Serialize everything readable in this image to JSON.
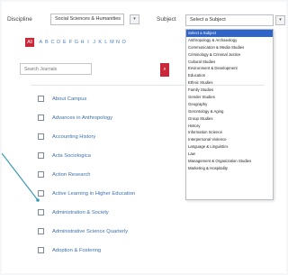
{
  "filters": {
    "discipline_label": "Discipline",
    "discipline_value": "Social Sciences & Humanities",
    "subject_label": "Subject",
    "subject_value": "Select a Subject"
  },
  "subject_options": [
    "Select a Subject",
    "Anthropology & Archaeology",
    "Communication & Media Studies",
    "Criminology & Criminal Justice",
    "Cultural Studies",
    "Environment & Development",
    "Education",
    "Ethnic Studies",
    "Family Studies",
    "Gender Studies",
    "Geography",
    "Gerontology & Aging",
    "Group Studies",
    "History",
    "Information Science",
    "Interpersonal Violence",
    "Language & Linguistics",
    "Law",
    "Management & Organization Studies",
    "Marketing & Hospitality"
  ],
  "alphabet": {
    "all_label": "All",
    "letters": [
      "A",
      "B",
      "C",
      "D",
      "E",
      "F",
      "G",
      "H",
      "I",
      "J",
      "K",
      "L",
      "M",
      "N",
      "O"
    ]
  },
  "search": {
    "placeholder": "Search Journals",
    "button_icon": "search-icon"
  },
  "journals": [
    "About Campus",
    "Advances in Anthropology",
    "Accounting History",
    "Acta Sociologica",
    "Action Research",
    "Active Learning in Higher Education",
    "Administration & Society",
    "Administrative Science Quarterly",
    "Adoption & Fostering"
  ],
  "colors": {
    "accent": "#c8283a",
    "link": "#3b6fb0",
    "highlight": "#2f64c8",
    "pointer": "#3d9bb8"
  }
}
